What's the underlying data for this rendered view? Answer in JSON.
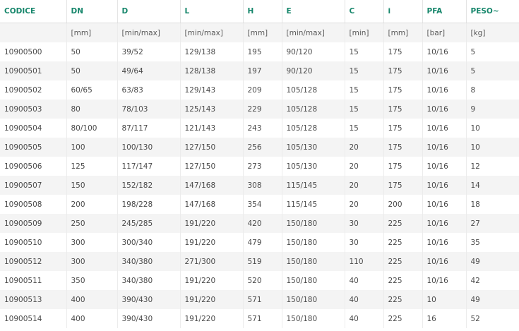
{
  "table": {
    "headers": [
      "CODICE",
      "DN",
      "D",
      "L",
      "H",
      "E",
      "C",
      "i",
      "PFA",
      "PESO~"
    ],
    "units": [
      "",
      "[mm]",
      "[min/max]",
      "[min/max]",
      "[mm]",
      "[min/max]",
      "[min]",
      "[mm]",
      "[bar]",
      "[kg]"
    ],
    "rows": [
      [
        "10900500",
        "50",
        "39/52",
        "129/138",
        "195",
        "90/120",
        "15",
        "175",
        "10/16",
        "5"
      ],
      [
        "10900501",
        "50",
        "49/64",
        "128/138",
        "197",
        "90/120",
        "15",
        "175",
        "10/16",
        "5"
      ],
      [
        "10900502",
        "60/65",
        "63/83",
        "129/143",
        "209",
        "105/128",
        "15",
        "175",
        "10/16",
        "8"
      ],
      [
        "10900503",
        "80",
        "78/103",
        "125/143",
        "229",
        "105/128",
        "15",
        "175",
        "10/16",
        "9"
      ],
      [
        "10900504",
        "80/100",
        "87/117",
        "121/143",
        "243",
        "105/128",
        "15",
        "175",
        "10/16",
        "10"
      ],
      [
        "10900505",
        "100",
        "100/130",
        "127/150",
        "256",
        "105/130",
        "20",
        "175",
        "10/16",
        "10"
      ],
      [
        "10900506",
        "125",
        "117/147",
        "127/150",
        "273",
        "105/130",
        "20",
        "175",
        "10/16",
        "12"
      ],
      [
        "10900507",
        "150",
        "152/182",
        "147/168",
        "308",
        "115/145",
        "20",
        "175",
        "10/16",
        "14"
      ],
      [
        "10900508",
        "200",
        "198/228",
        "147/168",
        "354",
        "115/145",
        "20",
        "200",
        "10/16",
        "18"
      ],
      [
        "10900509",
        "250",
        "245/285",
        "191/220",
        "420",
        "150/180",
        "30",
        "225",
        "10/16",
        "27"
      ],
      [
        "10900510",
        "300",
        "300/340",
        "191/220",
        "479",
        "150/180",
        "30",
        "225",
        "10/16",
        "35"
      ],
      [
        "10900512",
        "300",
        "340/380",
        "271/300",
        "519",
        "150/180",
        "110",
        "225",
        "10/16",
        "49"
      ],
      [
        "10900511",
        "350",
        "340/380",
        "191/220",
        "520",
        "150/180",
        "40",
        "225",
        "10/16",
        "42"
      ],
      [
        "10900513",
        "400",
        "390/430",
        "191/220",
        "571",
        "150/180",
        "40",
        "225",
        "10",
        "49"
      ],
      [
        "10900514",
        "400",
        "390/430",
        "191/220",
        "571",
        "150/180",
        "40",
        "225",
        "16",
        "52"
      ]
    ]
  }
}
